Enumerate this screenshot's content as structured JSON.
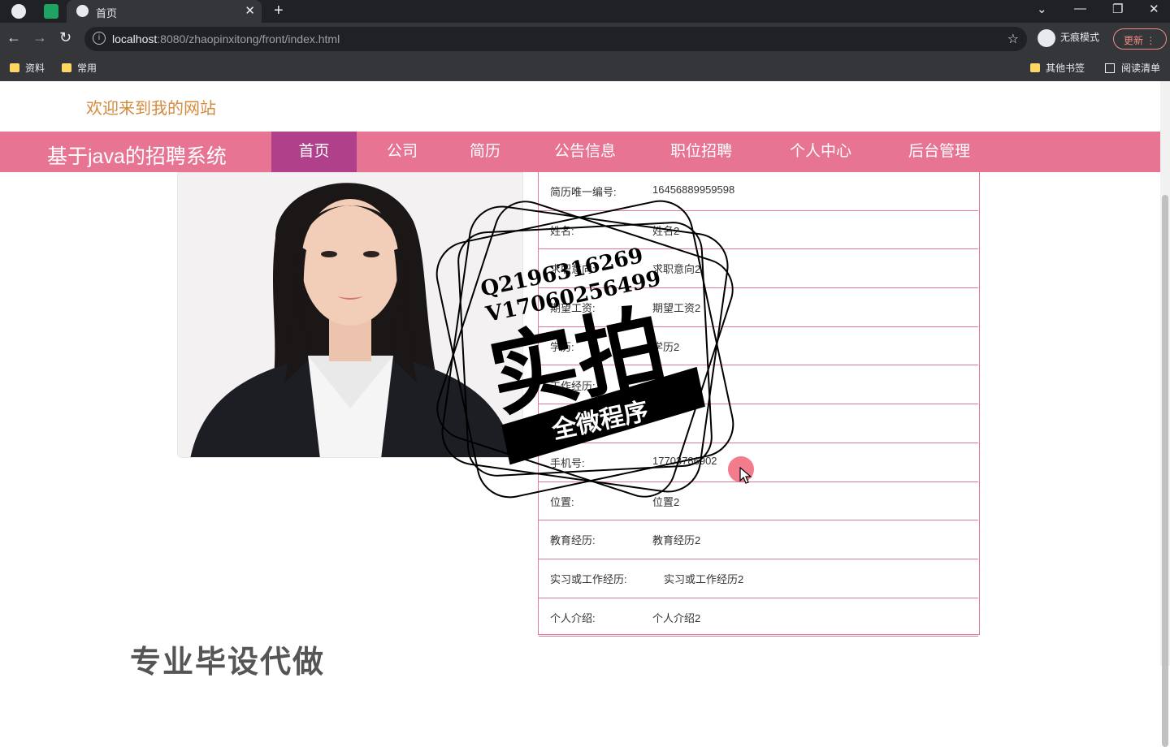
{
  "browser": {
    "tab_title": "首页",
    "url_host": "localhost",
    "url_rest": ":8080/zhaopinxitong/front/index.html",
    "incognito_label": "无痕模式",
    "update_label": "更新",
    "bookmarks": [
      "资料",
      "常用"
    ],
    "bookmarks_right": [
      "其他书签",
      "阅读清单"
    ]
  },
  "site": {
    "welcome": "欢迎来到我的网站",
    "title": "基于java的招聘系统",
    "nav": [
      "首页",
      "公司",
      "简历",
      "公告信息",
      "职位招聘",
      "个人中心",
      "后台管理"
    ],
    "active_nav": "首页"
  },
  "resume": {
    "rows": [
      {
        "label": "简历唯一编号:",
        "value": "16456889959598"
      },
      {
        "label": "姓名:",
        "value": "姓名2"
      },
      {
        "label": "求职意向:",
        "value": "求职意向2"
      },
      {
        "label": "期望工资:",
        "value": "期望工资2"
      },
      {
        "label": "学历:",
        "value": "学历2"
      },
      {
        "label": "工作经历:",
        "value": "工作经历2"
      },
      {
        "label": "",
        "value": ""
      },
      {
        "label": "手机号:",
        "value": "17703786902"
      },
      {
        "label": "位置:",
        "value": "位置2"
      },
      {
        "label": "教育经历:",
        "value": "教育经历2"
      },
      {
        "label": "实习或工作经历:",
        "value": "实习或工作经历2"
      },
      {
        "label": "个人介绍:",
        "value": "个人介绍2"
      }
    ]
  },
  "watermark": {
    "line1": "Q2196316269",
    "line2": "V17060256499",
    "big": "实拍",
    "ribbon": "全微程序"
  },
  "bottom_text": "专业毕设代做"
}
